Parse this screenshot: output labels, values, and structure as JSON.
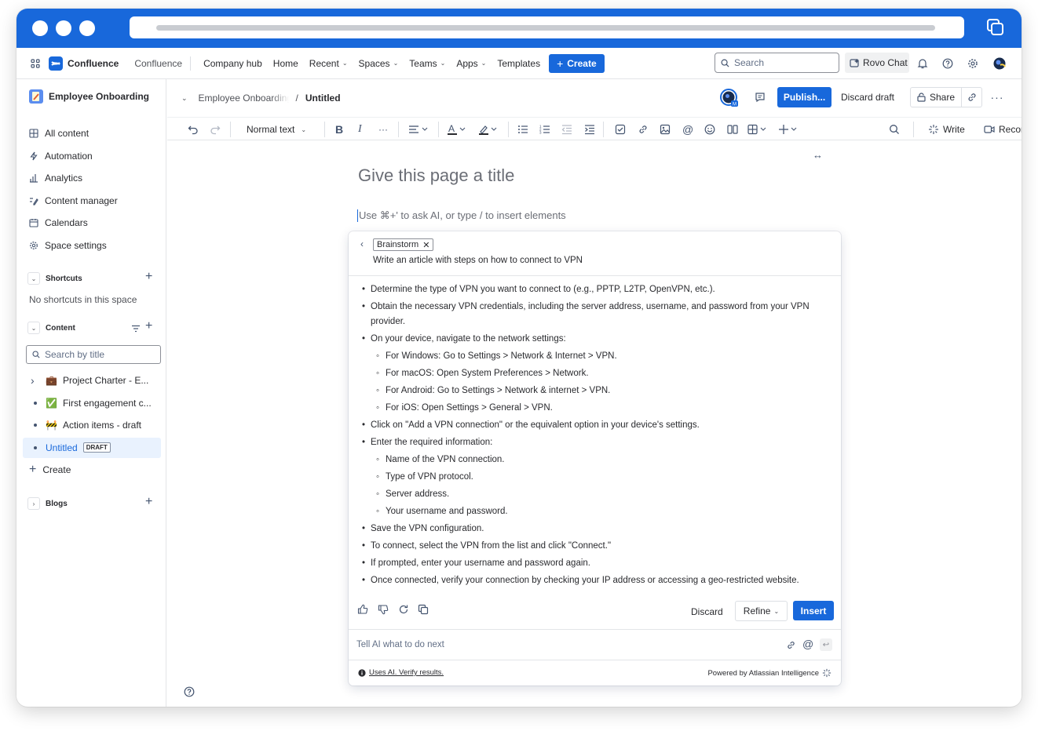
{
  "topnav": {
    "app_name": "Confluence",
    "space_label": "Confluence",
    "items": [
      {
        "label": "Company hub",
        "chevron": false
      },
      {
        "label": "Home",
        "chevron": false
      },
      {
        "label": "Recent",
        "chevron": true
      },
      {
        "label": "Spaces",
        "chevron": true
      },
      {
        "label": "Teams",
        "chevron": true
      },
      {
        "label": "Apps",
        "chevron": true
      },
      {
        "label": "Templates",
        "chevron": false
      }
    ],
    "create_label": "Create",
    "search_placeholder": "Search",
    "rovo_label": "Rovo Chat"
  },
  "sidebar": {
    "space_name": "Employee Onboarding",
    "nav": [
      {
        "label": "All content",
        "icon": "grid-icon"
      },
      {
        "label": "Automation",
        "icon": "bolt-icon"
      },
      {
        "label": "Analytics",
        "icon": "analytics-icon"
      },
      {
        "label": "Content manager",
        "icon": "content-manager-icon"
      },
      {
        "label": "Calendars",
        "icon": "calendar-icon"
      },
      {
        "label": "Space settings",
        "icon": "gear-icon"
      }
    ],
    "shortcuts_title": "Shortcuts",
    "shortcuts_empty": "No shortcuts in this space",
    "content_title": "Content",
    "search_placeholder": "Search by title",
    "tree": [
      {
        "label": "Project Charter - E...",
        "emoji": "💼",
        "expandable": true
      },
      {
        "label": "First engagement c...",
        "emoji": "✅",
        "expandable": false
      },
      {
        "label": "Action items - draft",
        "emoji": "🚧",
        "expandable": false
      },
      {
        "label": "Untitled",
        "emoji": "",
        "expandable": false,
        "badge": "DRAFT",
        "selected": true
      }
    ],
    "create_label": "Create",
    "blogs_title": "Blogs"
  },
  "editor": {
    "breadcrumb_parent": "Employee Onboarding",
    "breadcrumb_separator": "/",
    "breadcrumb_current": "Untitled",
    "publish_label": "Publish...",
    "discard_draft_label": "Discard draft",
    "share_label": "Share",
    "toolbar": {
      "text_style": "Normal text",
      "write_label": "Write",
      "record_label": "Record"
    },
    "title_placeholder": "Give this page a title",
    "hint": "Use ⌘+' to ask AI, or type / to insert elements"
  },
  "ai_panel": {
    "tag": "Brainstorm",
    "prompt": "Write an article with steps on how to connect to VPN",
    "items": [
      {
        "level": 1,
        "text": "Determine the type of VPN you want to connect to (e.g., PPTP, L2TP, OpenVPN, etc.)."
      },
      {
        "level": 1,
        "text": "Obtain the necessary VPN credentials, including the server address, username, and password from your VPN provider."
      },
      {
        "level": 1,
        "text": "On your device, navigate to the network settings:"
      },
      {
        "level": 2,
        "text": "For Windows: Go to Settings > Network & Internet > VPN."
      },
      {
        "level": 2,
        "text": "For macOS: Open System Preferences > Network."
      },
      {
        "level": 2,
        "text": "For Android: Go to Settings > Network & internet > VPN."
      },
      {
        "level": 2,
        "text": "For iOS: Open Settings > General > VPN."
      },
      {
        "level": 1,
        "text": "Click on \"Add a VPN connection\" or the equivalent option in your device's settings."
      },
      {
        "level": 1,
        "text": "Enter the required information:"
      },
      {
        "level": 2,
        "text": "Name of the VPN connection."
      },
      {
        "level": 2,
        "text": "Type of VPN protocol."
      },
      {
        "level": 2,
        "text": "Server address."
      },
      {
        "level": 2,
        "text": "Your username and password."
      },
      {
        "level": 1,
        "text": "Save the VPN configuration."
      },
      {
        "level": 1,
        "text": "To connect, select the VPN from the list and click \"Connect.\""
      },
      {
        "level": 1,
        "text": "If prompted, enter your username and password again."
      },
      {
        "level": 1,
        "text": "Once connected, verify your connection by checking your IP address or accessing a geo-restricted website."
      }
    ],
    "discard_label": "Discard",
    "refine_label": "Refine",
    "insert_label": "Insert",
    "input_placeholder": "Tell AI what to do next",
    "disclaimer": "Uses AI. Verify results.",
    "powered_by": "Powered by Atlassian Intelligence"
  },
  "colors": {
    "brand": "#1868db"
  }
}
